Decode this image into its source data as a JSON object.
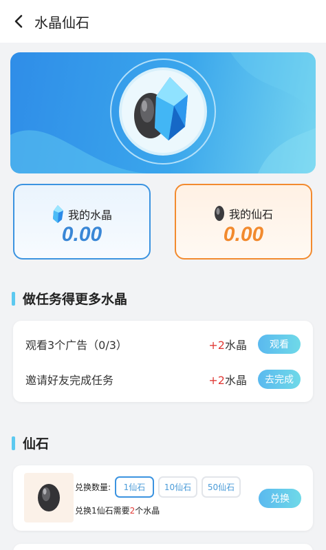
{
  "header": {
    "title": "水晶仙石"
  },
  "stats": {
    "crystal": {
      "label": "我的水晶",
      "value": "0.00"
    },
    "stone": {
      "label": "我的仙石",
      "value": "0.00"
    }
  },
  "tasks_section": {
    "title": "做任务得更多水晶",
    "tasks": [
      {
        "name": "观看3个广告（0/3）",
        "reward_plus": "+2",
        "reward_unit": "水晶",
        "button": "观看"
      },
      {
        "name": "邀请好友完成任务",
        "reward_plus": "+2",
        "reward_unit": "水晶",
        "button": "去完成"
      }
    ]
  },
  "stone_section": {
    "title": "仙石",
    "exchange": {
      "qty_label": "兑换数量:",
      "options": [
        "1仙石",
        "10仙石",
        "50仙石"
      ],
      "selected_option": "1仙石",
      "desc_prefix": "兑换1仙石需要",
      "desc_num": "2",
      "desc_suffix": "个水晶",
      "button": "兑换"
    }
  },
  "colors": {
    "accent_blue": "#3b93e0",
    "accent_orange": "#f28a2e",
    "reward_red": "#e13a36"
  },
  "icons": [
    "back-arrow-icon",
    "crystal-icon",
    "stone-icon"
  ]
}
